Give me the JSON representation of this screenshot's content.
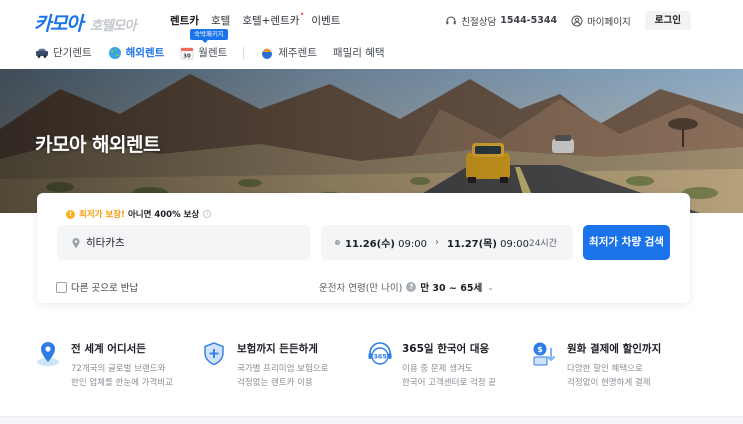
{
  "header": {
    "logo_main": "카모아",
    "logo_sub": "호텔모아",
    "nav": [
      {
        "label": "렌트카",
        "active": true
      },
      {
        "label": "호텔",
        "active": false
      },
      {
        "label": "호텔+렌트카",
        "active": false,
        "new": true
      },
      {
        "label": "이벤트",
        "active": false
      }
    ],
    "new_dot": "•",
    "support_label": "친절상담",
    "support_phone": "1544-5344",
    "mypage": "마이페이지",
    "login": "로그인"
  },
  "subnav": {
    "items": [
      {
        "label": "단기렌트",
        "icon": "car-icon",
        "active": false
      },
      {
        "label": "해외렌트",
        "icon": "globe-icon",
        "active": true
      },
      {
        "label": "월렌트",
        "icon": "calendar-icon",
        "active": false,
        "badge": "숙박패키지"
      },
      {
        "label": "제주렌트",
        "icon": "jeju-icon",
        "active": false
      },
      {
        "label": "패밀리 혜택",
        "icon": "",
        "active": false
      }
    ],
    "calendar_number": "30",
    "badge": "숙박패키지"
  },
  "hero": {
    "title": "카모아 해외렌트"
  },
  "search": {
    "guarantee_highlight": "최저가 보장!",
    "guarantee_text": "아니면 400% 보상",
    "guarantee_icon": "!",
    "location": "히타카츠",
    "pickup": "11.26(수)",
    "pickup_time": "09:00",
    "arrow": "›",
    "dropoff": "11.27(목)",
    "dropoff_time": "09:00",
    "duration": "24시간",
    "button": "최저가 차량 검색",
    "return_label": "다른 곳으로 반납",
    "age_label": "운전자 연령(만 나이)",
    "age_help": "?",
    "age_value": "만 30 ~ 65세",
    "age_chevron": "⌄"
  },
  "features": [
    {
      "title": "전 세계 어디서든",
      "desc": "72개국의 글로벌 브랜드와\n한인 업체를 한눈에 가격비교",
      "icon": "map-pin-icon"
    },
    {
      "title": "보험까지 든든하게",
      "desc": "국가별 프리미엄 보험으로\n걱정없는 렌트카 이용",
      "icon": "shield-plus-icon"
    },
    {
      "title": "365일 한국어 대응",
      "desc": "이용 중 문제 생겨도\n한국어 고객센터로 걱정 끝",
      "icon": "headset-icon"
    },
    {
      "title": "원화 결제에 할인까지",
      "desc": "다양한 할인 혜택으로\n걱정없이 현명하게 결제",
      "icon": "won-card-icon"
    }
  ],
  "feature_icon_texts": {
    "headset": "365"
  },
  "colors": {
    "brand": "#1a73e8",
    "highlight": "#f39a00"
  }
}
